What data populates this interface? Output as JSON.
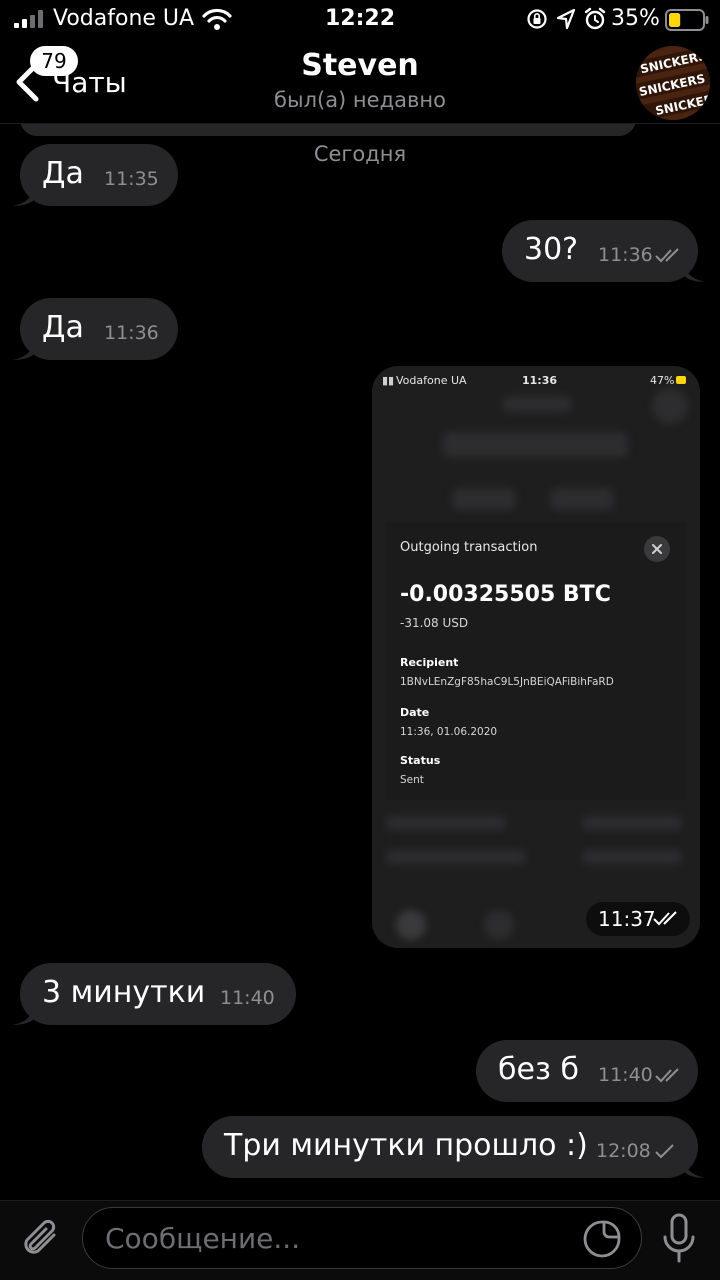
{
  "status_bar": {
    "carrier": "Vodafone UA",
    "time": "12:22",
    "battery_percent": "35%",
    "battery_level": 0.35,
    "battery_color": "#ffd60a"
  },
  "header": {
    "back_label": "Чаты",
    "unread_count": "79",
    "title": "Steven",
    "subtitle": "был(а) недавно",
    "avatar_text": "SNICKERS"
  },
  "chat": {
    "date_separator": "Сегодня",
    "messages": [
      {
        "side": "in",
        "text": "Да",
        "time": "11:35"
      },
      {
        "side": "out",
        "text": "30?",
        "time": "11:36",
        "status": "read"
      },
      {
        "side": "in",
        "text": "Да",
        "time": "11:36"
      },
      {
        "side": "out",
        "type": "image",
        "time": "11:37",
        "status": "read",
        "screenshot": {
          "carrier": "Vodafone UA",
          "time": "11:36",
          "battery": "47%",
          "card": {
            "heading": "Outgoing transaction",
            "amount": "-0.00325505 BTC",
            "usd": "-31.08 USD",
            "recipient_label": "Recipient",
            "recipient": "1BNvLEnZgF85haC9L5JnBEiQAFiBihFaRD",
            "date_label": "Date",
            "date": "11:36, 01.06.2020",
            "status_label": "Status",
            "status": "Sent"
          }
        }
      },
      {
        "side": "in",
        "text": "3 минутки",
        "time": "11:40"
      },
      {
        "side": "out",
        "text": "без б",
        "time": "11:40",
        "status": "read"
      },
      {
        "side": "out",
        "text": "Три минутки прошло :)",
        "time": "12:08",
        "status": "sent"
      }
    ]
  },
  "composer": {
    "placeholder": "Сообщение...",
    "value": ""
  },
  "colors": {
    "background": "#000000",
    "bubble": "#262628",
    "meta_text": "#8e8e93",
    "accent": "#ffffff"
  },
  "icons": [
    "signal-icon",
    "wifi-icon",
    "rotation-lock-icon",
    "location-icon",
    "alarm-icon",
    "battery-icon",
    "chevron-left-icon",
    "attachment-icon",
    "sticker-icon",
    "microphone-icon",
    "double-check-icon",
    "check-icon"
  ]
}
